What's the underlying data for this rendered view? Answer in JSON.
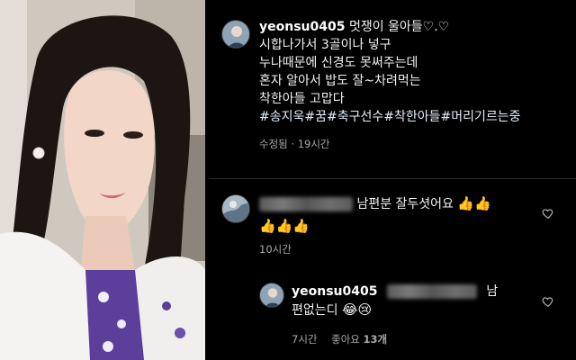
{
  "post": {
    "username": "yeonsu0405",
    "lines": [
      "멋쟁이 울아들♡.♡",
      "시합나가서 3골이나 넣구",
      "누나때문에 신경도 못써주는데",
      "혼자 알아서 밥도 잘~차려먹는",
      "착한아들 고맙다"
    ],
    "hashtags": "#송지욱#꿈#축구선수#착한아들#머리기르는중",
    "edited_label": "수정됨",
    "time": "19시간"
  },
  "comment1": {
    "text": "남편분 잘두셧어요",
    "emojis_line1": "👍👍",
    "emojis_line2": "👍👍👍",
    "time": "10시간"
  },
  "reply": {
    "username": "yeonsu0405",
    "text_suffix": "남",
    "text_line2": "편없는디",
    "emojis": "😂😢",
    "time": "7시간",
    "likes_label": "좋아요",
    "likes_count": "13개"
  },
  "icons": [
    "heart-icon",
    "heart-icon"
  ],
  "colors": {
    "background": "#000000",
    "meta": "#a8a8a8"
  }
}
